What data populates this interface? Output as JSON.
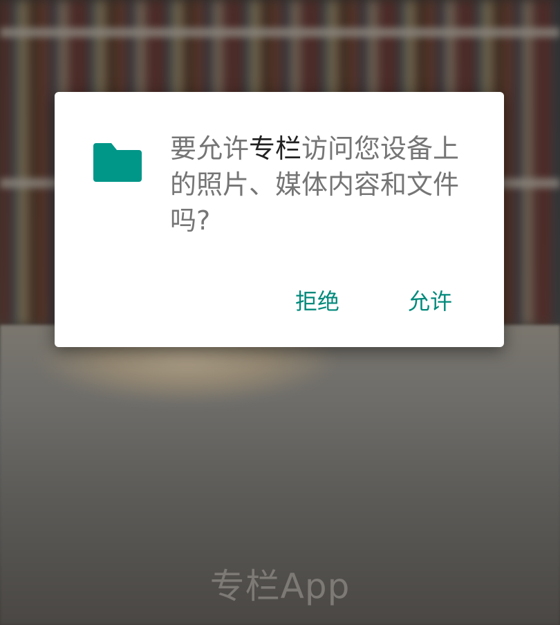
{
  "background": {
    "app_name": "专栏App"
  },
  "dialog": {
    "icon": "folder-icon",
    "icon_color": "#009688",
    "message_prefix": "要允许",
    "app_name": "专栏",
    "message_suffix": "访问您设备上的照片、媒体内容和文件吗?",
    "deny_label": "拒绝",
    "allow_label": "允许",
    "accent_color": "#00897b"
  }
}
